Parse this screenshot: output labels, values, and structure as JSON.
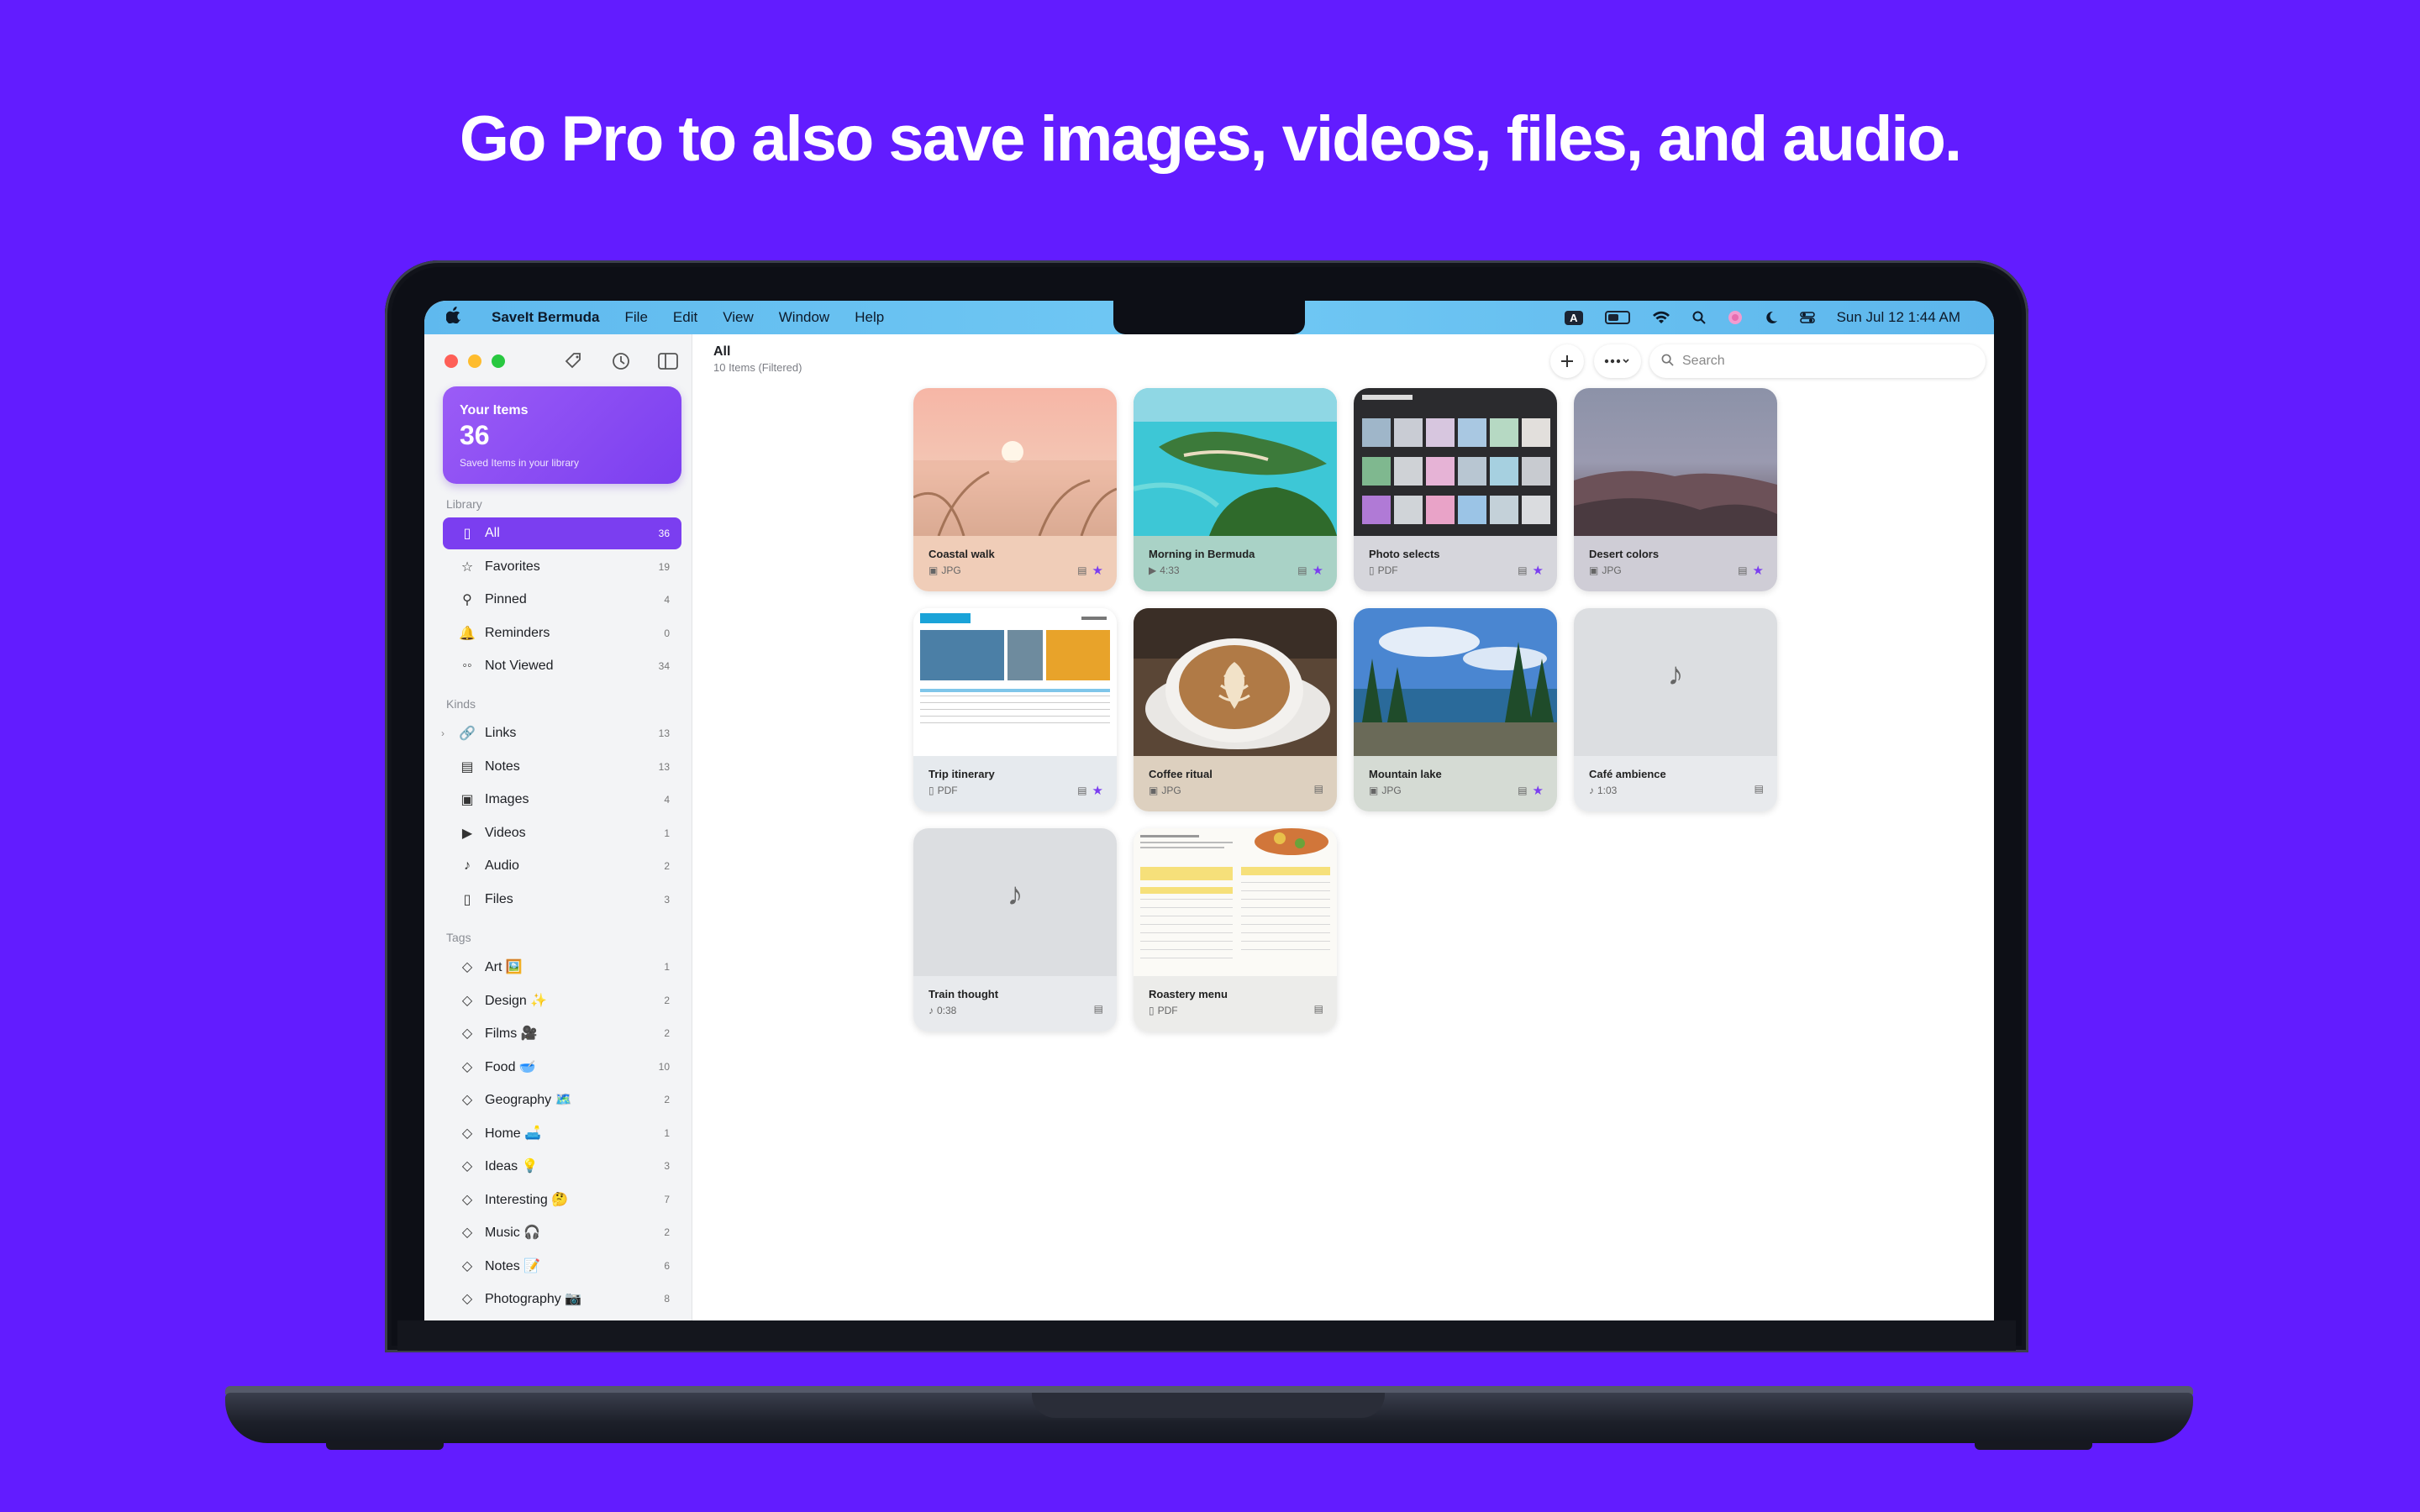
{
  "headline": "Go Pro to also save images, videos, files, and audio.",
  "menubar": {
    "app": "SaveIt Bermuda",
    "menus": [
      "File",
      "Edit",
      "View",
      "Window",
      "Help"
    ],
    "status": {
      "input": "A",
      "datetime": "Sun Jul 12  1:44 AM"
    }
  },
  "summary": {
    "title": "Your Items",
    "count": "36",
    "subtitle": "Saved Items in your library"
  },
  "sections": {
    "library": "Library",
    "kinds": "Kinds",
    "tags": "Tags"
  },
  "library": [
    {
      "label": "All",
      "count": "36",
      "icon": "bookmark-icon",
      "glyph": "▯"
    },
    {
      "label": "Favorites",
      "count": "19",
      "icon": "star-icon",
      "glyph": "☆"
    },
    {
      "label": "Pinned",
      "count": "4",
      "icon": "pin-icon",
      "glyph": "⚲"
    },
    {
      "label": "Reminders",
      "count": "0",
      "icon": "bell-icon",
      "glyph": "🔔"
    },
    {
      "label": "Not Viewed",
      "count": "34",
      "icon": "glasses-icon",
      "glyph": "◦◦"
    }
  ],
  "kinds": [
    {
      "label": "Links",
      "count": "13",
      "icon": "link-icon",
      "glyph": "🔗"
    },
    {
      "label": "Notes",
      "count": "13",
      "icon": "note-icon",
      "glyph": "▤"
    },
    {
      "label": "Images",
      "count": "4",
      "icon": "image-icon",
      "glyph": "▣"
    },
    {
      "label": "Videos",
      "count": "1",
      "icon": "video-icon",
      "glyph": "▶"
    },
    {
      "label": "Audio",
      "count": "2",
      "icon": "music-note-icon",
      "glyph": "♪"
    },
    {
      "label": "Files",
      "count": "3",
      "icon": "file-icon",
      "glyph": "▯"
    }
  ],
  "tags": [
    {
      "label": "Art 🖼️",
      "count": "1"
    },
    {
      "label": "Design ✨",
      "count": "2"
    },
    {
      "label": "Films 🎥",
      "count": "2"
    },
    {
      "label": "Food 🥣",
      "count": "10"
    },
    {
      "label": "Geography 🗺️",
      "count": "2"
    },
    {
      "label": "Home 🛋️",
      "count": "1"
    },
    {
      "label": "Ideas 💡",
      "count": "3"
    },
    {
      "label": "Interesting 🤔",
      "count": "7"
    },
    {
      "label": "Music 🎧",
      "count": "2"
    },
    {
      "label": "Notes 📝",
      "count": "6"
    },
    {
      "label": "Photography 📷",
      "count": "8"
    }
  ],
  "main": {
    "title": "All",
    "subtitle": "10 Items (Filtered)",
    "search_placeholder": "Search"
  },
  "items": [
    {
      "name": "Coastal walk",
      "meta": "JPG",
      "kind": "image",
      "favorite": true,
      "bg": "#f0cdb8"
    },
    {
      "name": "Morning in Bermuda",
      "meta": "4:33",
      "kind": "video",
      "favorite": true,
      "bg": "#a9d2c6"
    },
    {
      "name": "Photo selects",
      "meta": "PDF",
      "kind": "pdf",
      "favorite": true,
      "bg": "#d6d6dc"
    },
    {
      "name": "Desert colors",
      "meta": "JPG",
      "kind": "image",
      "favorite": true,
      "bg": "#cfcdd6"
    },
    {
      "name": "Trip itinerary",
      "meta": "PDF",
      "kind": "pdf",
      "favorite": true,
      "bg": "#e6eaee"
    },
    {
      "name": "Coffee ritual",
      "meta": "JPG",
      "kind": "image",
      "favorite": false,
      "bg": "#ddd0bf"
    },
    {
      "name": "Mountain lake",
      "meta": "JPG",
      "kind": "image",
      "favorite": true,
      "bg": "#d5dbd4"
    },
    {
      "name": "Café ambience",
      "meta": "1:03",
      "kind": "audio",
      "favorite": false,
      "bg": "#e8eaed"
    },
    {
      "name": "Train thought",
      "meta": "0:38",
      "kind": "audio",
      "favorite": false,
      "bg": "#e8eaed"
    },
    {
      "name": "Roastery menu",
      "meta": "PDF",
      "kind": "pdf",
      "favorite": false,
      "bg": "#ececea"
    }
  ],
  "colors": {
    "background": "#621cff",
    "accent": "#7b3ef0"
  }
}
